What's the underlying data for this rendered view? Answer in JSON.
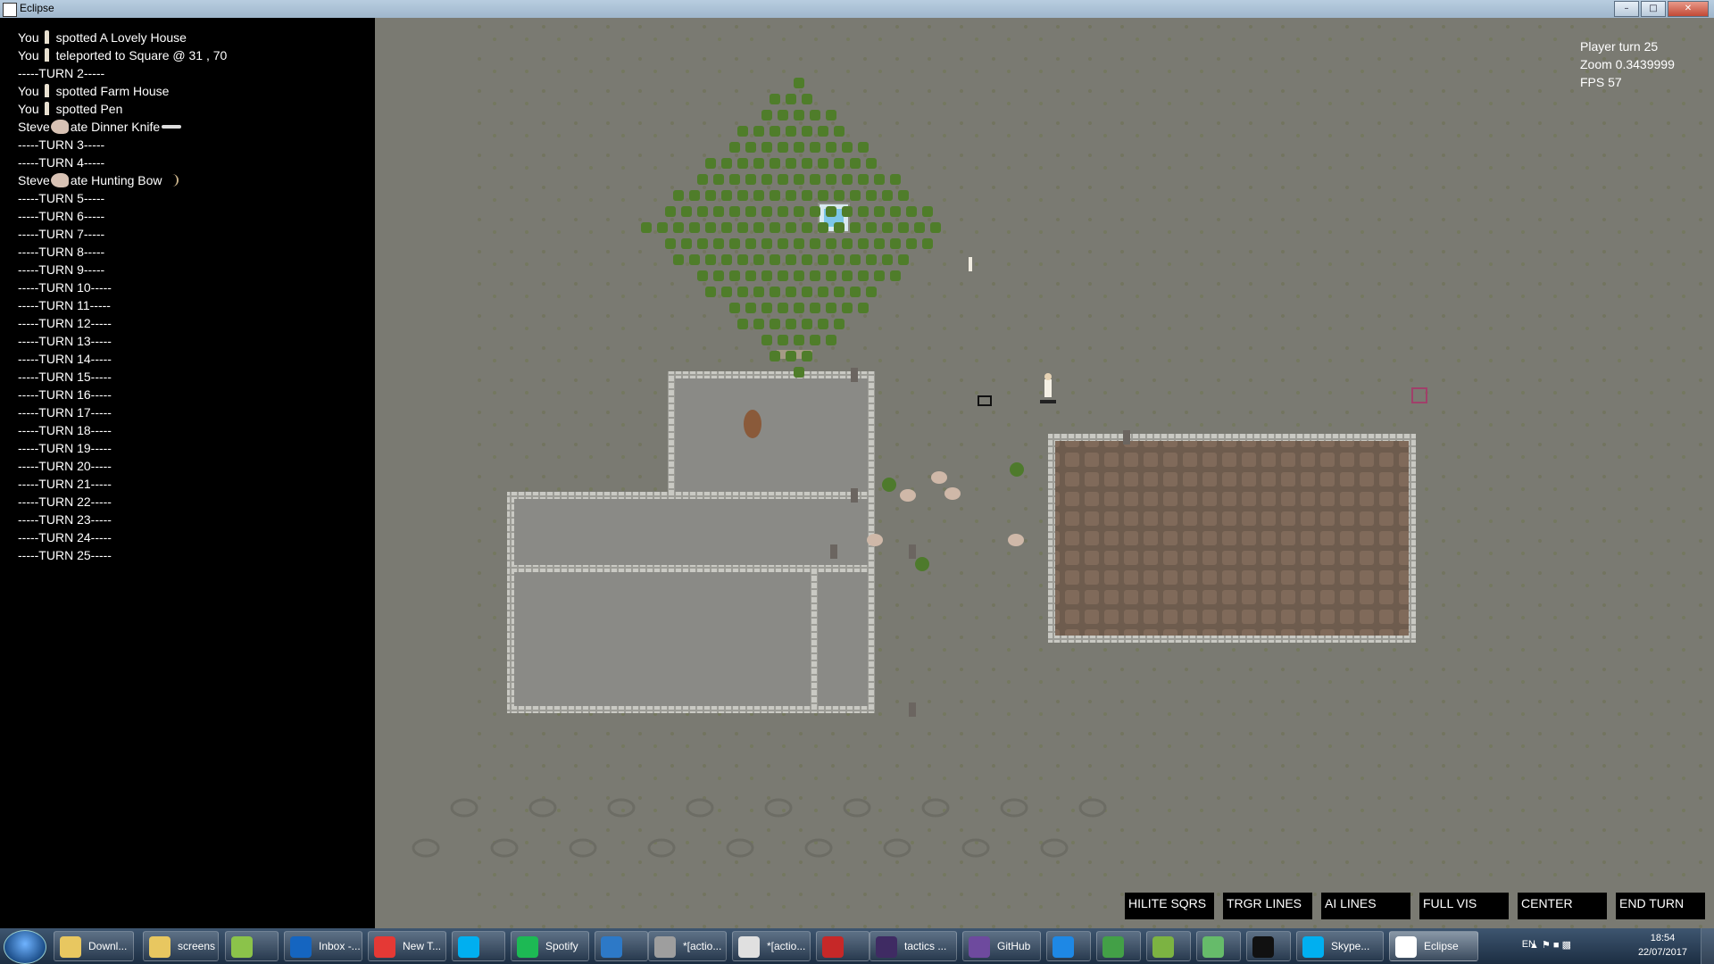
{
  "window": {
    "title": "Eclipse"
  },
  "log": {
    "lines": [
      {
        "actor": "You",
        "icon": "person",
        "text": "spotted A Lovely House"
      },
      {
        "actor": "You",
        "icon": "person",
        "text": "teleported to Square @ 31 , 70"
      },
      {
        "actor": "",
        "icon": "",
        "text": "-----TURN 2-----"
      },
      {
        "actor": "You",
        "icon": "person",
        "text": "spotted Farm House"
      },
      {
        "actor": "You",
        "icon": "person",
        "text": "spotted Pen"
      },
      {
        "actor": "Steve",
        "icon": "pig",
        "text": "ate Dinner Knife",
        "item_icon": "knife"
      },
      {
        "actor": "",
        "icon": "",
        "text": "-----TURN 3-----"
      },
      {
        "actor": "",
        "icon": "",
        "text": "-----TURN 4-----"
      },
      {
        "actor": "Steve",
        "icon": "pig",
        "text": "ate Hunting Bow",
        "item_icon": "bow"
      },
      {
        "actor": "",
        "icon": "",
        "text": "-----TURN 5-----"
      },
      {
        "actor": "",
        "icon": "",
        "text": "-----TURN 6-----"
      },
      {
        "actor": "",
        "icon": "",
        "text": "-----TURN 7-----"
      },
      {
        "actor": "",
        "icon": "",
        "text": "-----TURN 8-----"
      },
      {
        "actor": "",
        "icon": "",
        "text": "-----TURN 9-----"
      },
      {
        "actor": "",
        "icon": "",
        "text": "-----TURN 10-----"
      },
      {
        "actor": "",
        "icon": "",
        "text": "-----TURN 11-----"
      },
      {
        "actor": "",
        "icon": "",
        "text": "-----TURN 12-----"
      },
      {
        "actor": "",
        "icon": "",
        "text": "-----TURN 13-----"
      },
      {
        "actor": "",
        "icon": "",
        "text": "-----TURN 14-----"
      },
      {
        "actor": "",
        "icon": "",
        "text": "-----TURN 15-----"
      },
      {
        "actor": "",
        "icon": "",
        "text": "-----TURN 16-----"
      },
      {
        "actor": "",
        "icon": "",
        "text": "-----TURN 17-----"
      },
      {
        "actor": "",
        "icon": "",
        "text": "-----TURN 18-----"
      },
      {
        "actor": "",
        "icon": "",
        "text": "-----TURN 19-----"
      },
      {
        "actor": "",
        "icon": "",
        "text": "-----TURN 20-----"
      },
      {
        "actor": "",
        "icon": "",
        "text": "-----TURN 21-----"
      },
      {
        "actor": "",
        "icon": "",
        "text": "-----TURN 22-----"
      },
      {
        "actor": "",
        "icon": "",
        "text": "-----TURN 23-----"
      },
      {
        "actor": "",
        "icon": "",
        "text": "-----TURN 24-----"
      },
      {
        "actor": "",
        "icon": "",
        "text": "-----TURN 25-----"
      }
    ]
  },
  "hud": {
    "player_turn": "Player turn 25",
    "zoom": "Zoom 0.3439999",
    "fps": "FPS 57"
  },
  "game_buttons": [
    "HILITE SQRS",
    "TRGR LINES",
    "AI LINES",
    "FULL VIS",
    "CENTER",
    "END TURN"
  ],
  "map": {
    "objects": [
      "crop-field",
      "water-trough",
      "farm-house",
      "pig-pen",
      "pigs",
      "shrubs",
      "footprint-trail",
      "player-character",
      "hostile-character"
    ],
    "colors": {
      "ground": "#7a7a72",
      "crop": "#4f7d2a",
      "wall": "#b4b4ae",
      "floor": "#8a8a86",
      "pen_floor": "#7a6656"
    }
  },
  "taskbar": {
    "items": [
      {
        "label": "Downl...",
        "icon": "folder-icon",
        "color": "#e8c760"
      },
      {
        "label": "screens",
        "icon": "folder-icon",
        "color": "#e8c760"
      },
      {
        "label": "",
        "icon": "android-icon",
        "color": "#8bc34a"
      },
      {
        "label": "Inbox -...",
        "icon": "outlook-icon",
        "color": "#1565c0"
      },
      {
        "label": "New T...",
        "icon": "chrome-icon",
        "color": "#e53935"
      },
      {
        "label": "",
        "icon": "skype-icon",
        "color": "#00aff0"
      },
      {
        "label": "Spotify",
        "icon": "spotify-icon",
        "color": "#1db954"
      },
      {
        "label": "",
        "icon": "app-icon",
        "color": "#2d79c7"
      },
      {
        "label": "*[actio...",
        "icon": "gear-icon",
        "color": "#9e9e9e"
      },
      {
        "label": "*[actio...",
        "icon": "splash-icon",
        "color": "#e0e0e0"
      },
      {
        "label": "",
        "icon": "paint-icon",
        "color": "#c62828"
      },
      {
        "label": "tactics ...",
        "icon": "eclipse-icon",
        "color": "#3f2b63"
      },
      {
        "label": "GitHub",
        "icon": "github-icon",
        "color": "#6e4a9e"
      },
      {
        "label": "",
        "icon": "upload-icon",
        "color": "#1e88e5"
      },
      {
        "label": "",
        "icon": "sourcetree-icon",
        "color": "#43a047"
      },
      {
        "label": "",
        "icon": "notepad-icon",
        "color": "#7cb342"
      },
      {
        "label": "",
        "icon": "house-icon",
        "color": "#66bb6a"
      },
      {
        "label": "",
        "icon": "terminal-icon",
        "color": "#111111"
      },
      {
        "label": "Skype...",
        "icon": "skype-icon",
        "color": "#00aff0"
      },
      {
        "label": "Eclipse",
        "icon": "eclipse-icon",
        "color": "#ffffff"
      }
    ],
    "language": "EN",
    "time": "18:54",
    "date": "22/07/2017"
  }
}
